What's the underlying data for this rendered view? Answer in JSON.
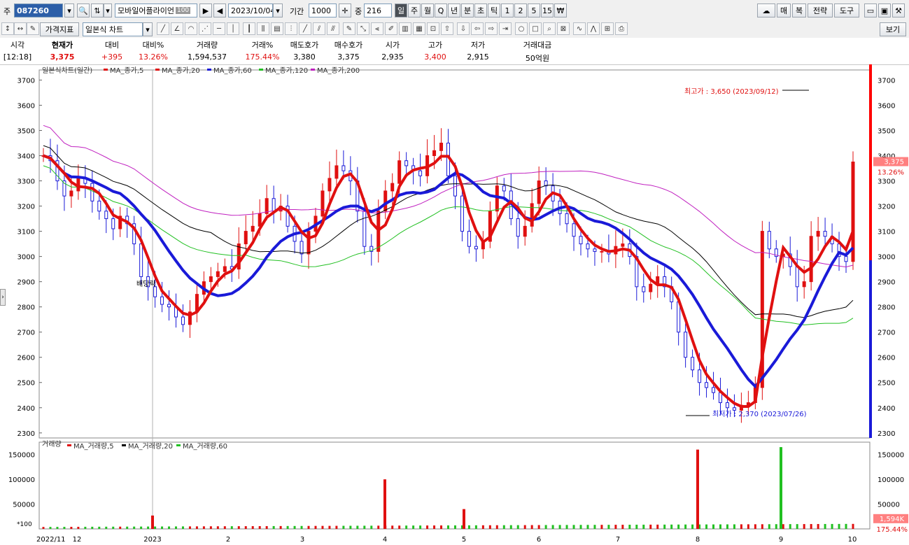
{
  "toolbar": {
    "market_label": "주",
    "stock_code": "087260",
    "stock_name": "모바일어플라이언",
    "stock_name_badge": "100",
    "date": "2023/10/04",
    "period_label": "기간",
    "period_value": "1000",
    "count_label": "중",
    "count_value": "216",
    "periods": [
      "일",
      "주",
      "월",
      "Q",
      "년",
      "분",
      "초",
      "틱",
      "1",
      "2",
      "5",
      "15"
    ],
    "selected_period": "일",
    "right_buttons": [
      "매",
      "복",
      "전략",
      "도구"
    ]
  },
  "toolbar2": {
    "indicator_button": "가격지표",
    "chart_type": "일본식 차트",
    "view_button": "보기"
  },
  "quote": {
    "headers": [
      "시각",
      "현재가",
      "대비",
      "대비%",
      "거래량",
      "거래%",
      "매도호가",
      "매수호가",
      "시가",
      "고가",
      "저가",
      "거래대금"
    ],
    "values": [
      "[12:18]",
      "3,375",
      "+395",
      "13.26%",
      "1,594,537",
      "175.44%",
      "3,380",
      "3,375",
      "2,935",
      "3,400",
      "2,915",
      "50억원"
    ],
    "colors": [
      "#000000",
      "#e01010",
      "#e01010",
      "#e01010",
      "#000000",
      "#e01010",
      "#000000",
      "#000000",
      "#000000",
      "#e01010",
      "#000000",
      "#000000"
    ]
  },
  "chart_data": {
    "type": "candlestick",
    "title": "일본식차트(일간)",
    "legend": [
      {
        "name": "MA_종가,5",
        "color": "#e01010"
      },
      {
        "name": "MA_종가,20",
        "color": "#e01010"
      },
      {
        "name": "MA_종가,60",
        "color": "#1a1ad8"
      },
      {
        "name": "MA_종가,120",
        "color": "#22c022"
      },
      {
        "name": "MA_종가,200",
        "color": "#c020c0"
      }
    ],
    "ylim": [
      2280,
      3740
    ],
    "y_ticks": [
      2300,
      2400,
      2500,
      2600,
      2700,
      2800,
      2900,
      3000,
      3100,
      3200,
      3300,
      3400,
      3500,
      3600,
      3700
    ],
    "x_labels": [
      "2022/11",
      "12",
      "2023",
      "2",
      "3",
      "4",
      "5",
      "6",
      "7",
      "8",
      "9",
      "10"
    ],
    "high_annotation": "최고가 : 3,650 (2023/09/12)",
    "low_annotation": "최저가 : 2,370 (2023/07/26)",
    "event_label": "배당락",
    "current_price_label": "3,375",
    "current_change_label": "13.26%",
    "close_series": [
      3400,
      3380,
      3300,
      3240,
      3260,
      3310,
      3290,
      3220,
      3180,
      3150,
      3110,
      3160,
      3130,
      3050,
      2920,
      2880,
      2840,
      2810,
      2800,
      2760,
      2730,
      2780,
      2850,
      2900,
      2920,
      2940,
      2960,
      2950,
      3050,
      3100,
      3120,
      3170,
      3230,
      3180,
      3200,
      3120,
      3060,
      3010,
      3100,
      3160,
      3260,
      3310,
      3360,
      3340,
      3300,
      3180,
      3040,
      3020,
      3180,
      3260,
      3290,
      3380,
      3360,
      3340,
      3320,
      3400,
      3420,
      3450,
      3320,
      3240,
      3100,
      3040,
      3030,
      3060,
      3180,
      3280,
      3260,
      3150,
      3080,
      3120,
      3210,
      3300,
      3280,
      3220,
      3170,
      3130,
      3080,
      3050,
      3030,
      3020,
      3020,
      3010,
      3040,
      3050,
      3000,
      2880,
      2860,
      2890,
      2920,
      2880,
      2820,
      2700,
      2600,
      2550,
      2500,
      2480,
      2460,
      2420,
      2400,
      2390,
      2410,
      2420,
      2480,
      3100,
      3030,
      3000,
      3010,
      2960,
      2880,
      2900,
      3080,
      3100,
      3080,
      3050,
      3000,
      2980,
      3375
    ],
    "volume": {
      "title": "거래량",
      "legend": [
        {
          "name": "MA_거래량,5",
          "color": "#e01010"
        },
        {
          "name": "MA_거래량,20",
          "color": "#000000"
        },
        {
          "name": "MA_거래량,60",
          "color": "#22c022"
        }
      ],
      "ylim": [
        0,
        175000
      ],
      "y_ticks": [
        50000,
        100000,
        150000
      ],
      "scale_label": "*100",
      "current_volume_label": "1,594K",
      "current_ratio_label": "175.44%",
      "spikes": [
        {
          "month_index": 2,
          "value": 27000
        },
        {
          "month_index": 5,
          "value": 100000
        },
        {
          "month_index": 6,
          "value": 40000
        },
        {
          "month_index": 9,
          "value": 160000
        },
        {
          "month_index": 10,
          "value": 165000
        }
      ]
    }
  }
}
